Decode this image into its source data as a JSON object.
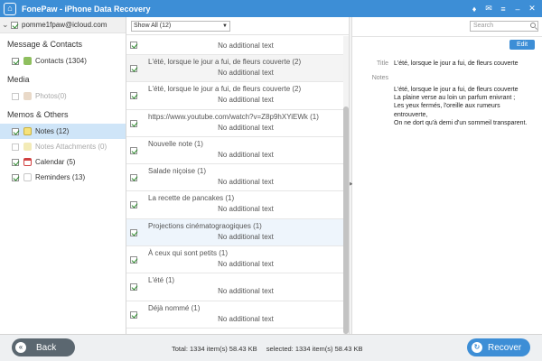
{
  "app": {
    "title": "FonePaw - iPhone Data Recovery",
    "window_controls": [
      "♦",
      "✉",
      "≡",
      "–",
      "✕"
    ]
  },
  "sidebar": {
    "account": "pomme1fpaw@icloud.com",
    "sections": [
      {
        "header": "Message & Contacts",
        "items": [
          {
            "label": "Contacts (1304)",
            "checked": true,
            "dim": false,
            "icon": "contacts-icon"
          }
        ]
      },
      {
        "header": "Media",
        "items": [
          {
            "label": "Photos(0)",
            "checked": false,
            "dim": true,
            "icon": "photos-icon"
          }
        ]
      },
      {
        "header": "Memos & Others",
        "items": [
          {
            "label": "Notes (12)",
            "checked": true,
            "dim": false,
            "selected": true,
            "icon": "notes-icon"
          },
          {
            "label": "Notes Attachments (0)",
            "checked": false,
            "dim": true,
            "icon": "attachments-icon"
          },
          {
            "label": "Calendar (5)",
            "checked": true,
            "dim": false,
            "icon": "calendar-icon"
          },
          {
            "label": "Reminders (13)",
            "checked": true,
            "dim": false,
            "icon": "reminders-icon"
          }
        ]
      }
    ]
  },
  "list": {
    "filter": "Show All (12)",
    "first_sub": "No additional text",
    "items": [
      {
        "title": "L'été, lorsque le jour a fui, de fleurs couverte (2)",
        "sub": "No additional text"
      },
      {
        "title": "L'été, lorsque le jour a fui, de fleurs couverte (2)",
        "sub": "No additional text"
      },
      {
        "title": "https://www.youtube.com/watch?v=Z8p9hXYiEWk (1)",
        "sub": "No additional text"
      },
      {
        "title": "Nouvelle note (1)",
        "sub": "No additional text"
      },
      {
        "title": "Salade niçoise (1)",
        "sub": "No additional text"
      },
      {
        "title": "La recette de pancakes (1)",
        "sub": "No additional text"
      },
      {
        "title": "Projections cinématograogiques (1)",
        "sub": "No additional text"
      },
      {
        "title": "À ceux qui sont petits (1)",
        "sub": "No additional text"
      },
      {
        "title": "L'été (1)",
        "sub": "No additional text"
      },
      {
        "title": "Déjà nommé (1)",
        "sub": "No additional text"
      }
    ]
  },
  "detail": {
    "search_placeholder": "Search",
    "edit_label": "Edit",
    "title_label": "Title",
    "title_value": "L'été, lorsque le jour a fui, de fleurs couverte",
    "notes_label": "Notes",
    "notes_text": "L'été, lorsque le jour a fui, de fleurs couverte\nLa plaine verse au loin un parfum enivrant ;\nLes yeux fermés, l'oreille aux rumeurs entrouverte,\nOn ne dort qu'à demi d'un sommeil transparent."
  },
  "footer": {
    "back_label": "Back",
    "total": "Total: 1334 item(s) 58.43 KB",
    "selected": "selected: 1334 item(s) 58.43 KB",
    "recover_label": "Recover"
  }
}
